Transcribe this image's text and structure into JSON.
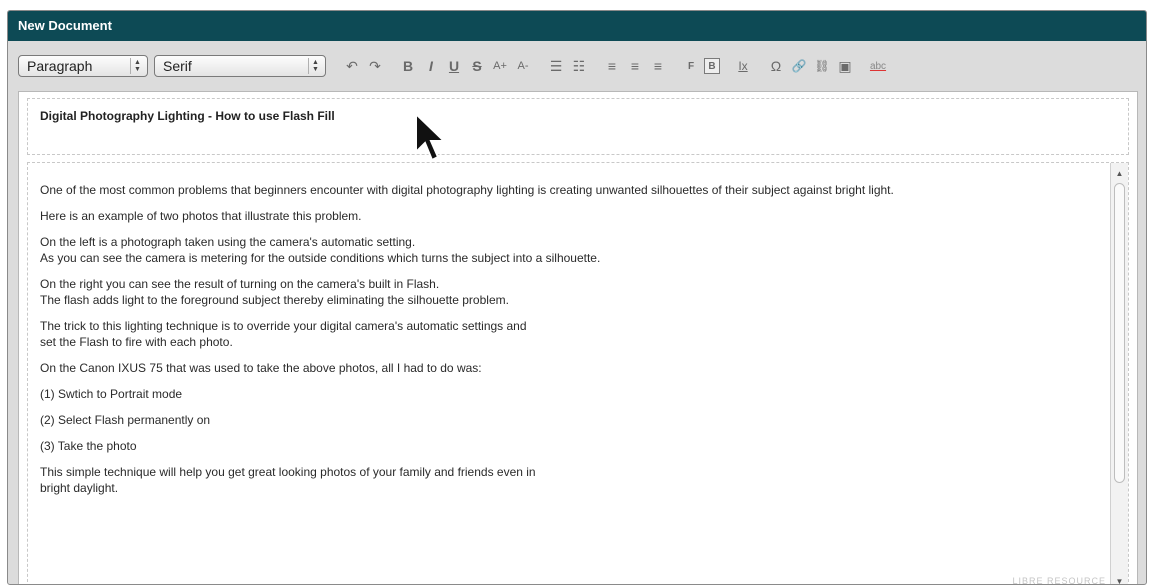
{
  "window": {
    "title": "New Document"
  },
  "toolbar": {
    "block_format": "Paragraph",
    "font_family": "Serif",
    "undo_icon": "↶",
    "redo_icon": "↷",
    "bold": "B",
    "italic": "I",
    "underline": "U",
    "strikethrough": "S",
    "font_bigger": "A+",
    "font_smaller": "A-",
    "bullet_list_icon": "☰",
    "numbered_list_icon": "☷",
    "align_left_icon": "≡",
    "align_center_icon": "≡",
    "align_right_icon": "≡",
    "flash_f": "F",
    "flash_b": "B",
    "clear_format": "Ix",
    "omega": "Ω",
    "link_icon": "🔗",
    "unlink_icon": "⛓",
    "image_icon": "▣",
    "spellcheck": "abc"
  },
  "editor": {
    "title": "Digital Photography Lighting - How to use Flash Fill",
    "paragraphs": [
      [
        "One of the most common problems that beginners encounter with digital photography lighting is creating unwanted silhouettes of their subject against bright light."
      ],
      [
        "Here is an example of two photos that illustrate this problem."
      ],
      [
        "On the left is a photograph taken using the camera's automatic setting.",
        "As you can see the camera is metering for the outside conditions which turns the subject into a silhouette."
      ],
      [
        "On the right you can see the result of turning on the camera's built in Flash.",
        "The flash adds light to the foreground subject thereby eliminating the silhouette problem."
      ],
      [
        "The trick to this lighting technique is to override your digital camera's automatic settings and",
        "set the Flash to fire with each photo."
      ],
      [
        "On the Canon IXUS 75 that was used to take the above photos, all I had to do was:"
      ],
      [
        "(1) Swtich to Portrait mode"
      ],
      [
        "(2) Select Flash permanently on"
      ],
      [
        "(3) Take the photo"
      ],
      [
        "This simple technique will help you get great looking photos of your family and friends even in",
        "bright daylight."
      ]
    ]
  },
  "watermark": "LIBRE RESOURCE"
}
